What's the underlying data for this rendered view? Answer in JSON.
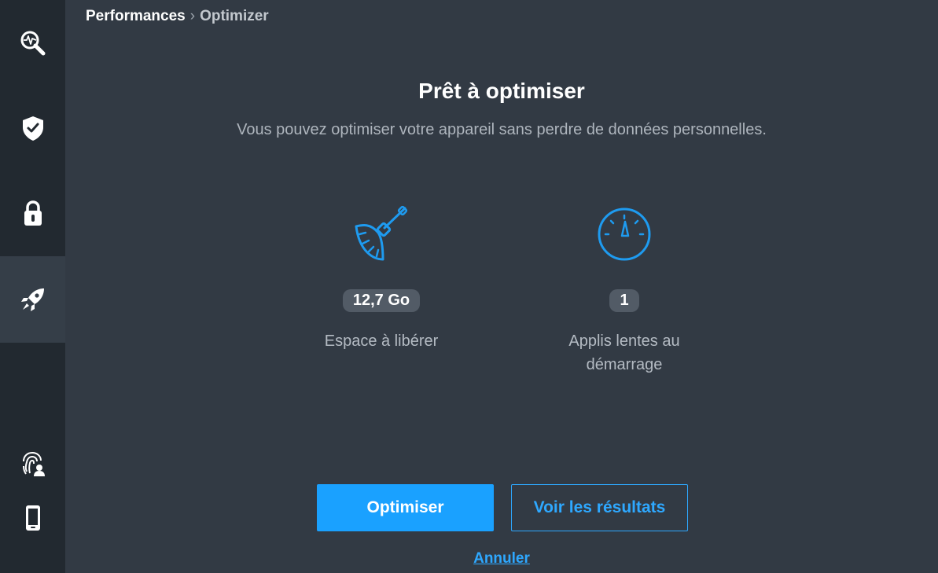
{
  "sidebar": {
    "items": [
      {
        "name": "analysis",
        "icon": "magnifier-pulse-icon"
      },
      {
        "name": "protection",
        "icon": "shield-check-icon"
      },
      {
        "name": "privacy",
        "icon": "lock-icon"
      },
      {
        "name": "performance",
        "icon": "rocket-icon",
        "active": true
      },
      {
        "name": "identity",
        "icon": "fingerprint-user-icon"
      },
      {
        "name": "device",
        "icon": "smartphone-icon"
      }
    ]
  },
  "breadcrumb": {
    "root": "Performances",
    "separator": "›",
    "current": "Optimizer"
  },
  "main": {
    "title": "Prêt à optimiser",
    "subtitle": "Vous pouvez optimiser votre appareil sans perdre de données personnelles."
  },
  "stats": [
    {
      "icon": "broom-icon",
      "value": "12,7 Go",
      "label": "Espace à libérer"
    },
    {
      "icon": "speedometer-icon",
      "value": "1",
      "label_line1": "Applis lentes au",
      "label_line2": "démarrage"
    }
  ],
  "actions": {
    "optimize_label": "Optimiser",
    "results_label": "Voir les résultats",
    "cancel_label": "Annuler"
  },
  "colors": {
    "accent": "#1aa1ff",
    "background": "#323a44",
    "sidebar": "#222930",
    "sidebar_active": "#353e48",
    "badge": "#525b66"
  }
}
